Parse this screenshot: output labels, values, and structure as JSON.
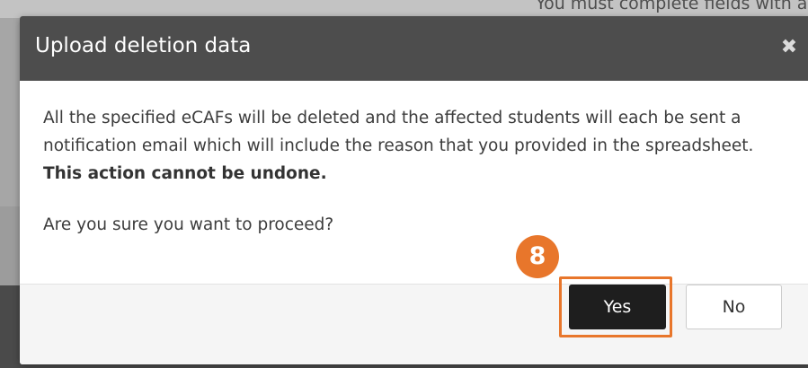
{
  "background": {
    "top_text": "You must complete fields with a"
  },
  "modal": {
    "title": "Upload deletion data",
    "close_glyph": "✖",
    "body": {
      "paragraph1_main": "All the specified eCAFs will be deleted and the affected students will each be sent a notification email which will include the reason that you provided in the spreadsheet. ",
      "paragraph1_bold": "This action cannot be undone.",
      "paragraph2": "Are you sure you want to proceed?"
    },
    "footer": {
      "yes_label": "Yes",
      "no_label": "No"
    }
  },
  "annotation": {
    "step_number": "8",
    "highlight_color": "#e8762b"
  },
  "colors": {
    "header_bg": "#4d4d4d",
    "primary_button_bg": "#1e1e1e",
    "accent": "#e8762b"
  }
}
